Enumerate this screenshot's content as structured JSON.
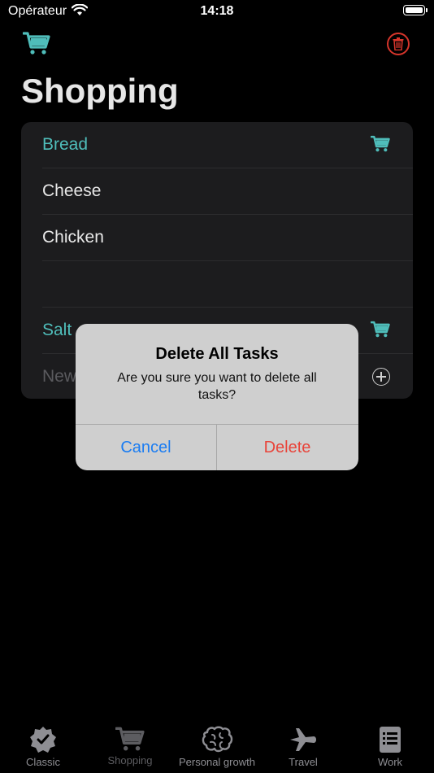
{
  "status_bar": {
    "carrier": "Opérateur",
    "time": "14:18"
  },
  "header": {
    "title": "Shopping"
  },
  "list": {
    "items": [
      {
        "label": "Bread",
        "accent": true,
        "in_cart": true
      },
      {
        "label": "Cheese",
        "accent": false,
        "in_cart": false
      },
      {
        "label": "Chicken",
        "accent": false,
        "in_cart": false
      },
      {
        "label": "",
        "accent": false,
        "in_cart": false
      },
      {
        "label": "Salt",
        "accent": true,
        "in_cart": true
      }
    ],
    "new_item_placeholder": "New"
  },
  "alert": {
    "title": "Delete All Tasks",
    "message": "Are you sure you want to delete all tasks?",
    "cancel_label": "Cancel",
    "delete_label": "Delete"
  },
  "tabs": [
    {
      "label": "Classic",
      "icon": "check-badge-icon"
    },
    {
      "label": "Shopping",
      "icon": "cart-icon"
    },
    {
      "label": "Personal growth",
      "icon": "brain-icon"
    },
    {
      "label": "Travel",
      "icon": "airplane-icon"
    },
    {
      "label": "Work",
      "icon": "notepad-icon"
    }
  ],
  "colors": {
    "accent": "#4fbdba",
    "destructive": "#e8443a",
    "link": "#1a7cf2",
    "card": "#1c1c1e"
  }
}
